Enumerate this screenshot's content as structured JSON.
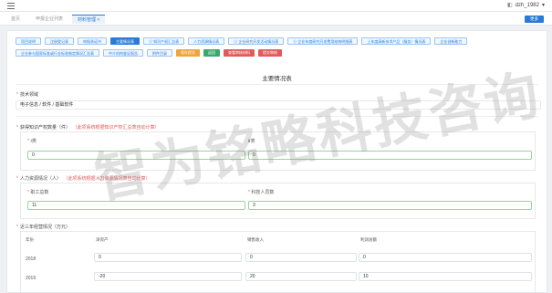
{
  "header": {
    "user_name": "dzh_1982"
  },
  "tabs": [
    {
      "label": "首页"
    },
    {
      "label": "申报企业列表"
    },
    {
      "label": "材料管理"
    }
  ],
  "more_button": "更多",
  "toolbar_row1": [
    "项目说明",
    "注册登记表",
    "申报承诺书",
    "主要情况表",
    "知识产权汇总表",
    "人力资源情况表",
    "企业研究开发活动情况表",
    "企业年度研究开发费用结构明细表",
    "上年度高新技术产品（服务）情况表",
    "企业创新能力"
  ],
  "toolbar_row2": [
    "企业参与国家标准或行业标准制定情况汇总表",
    "中介机构鉴证报告",
    "附件目录",
    "保存提交",
    "返回",
    "查看审核材料",
    "提交审核"
  ],
  "form": {
    "title": "主要情况表",
    "tech_field": {
      "label": "技术领域",
      "value": "电子信息 / 软件 / 基础软件"
    },
    "ip": {
      "label": "获得知识产权数量（件）",
      "note": "（此项系统根据知识产权汇总表自动计算）",
      "class1_label": "Ⅰ类",
      "class1_value": "0",
      "class2_label": "Ⅱ类",
      "class2_value": "0"
    },
    "hr": {
      "label": "人力资源情况（人）",
      "note": "（此项系统根据人力资源情况表自动计算）",
      "staff_label": "职工总数",
      "staff_value": "11",
      "tech_label": "科技人员数",
      "tech_value": "3"
    },
    "finance": {
      "label": "近三年经营情况（万元）",
      "headers": [
        "年份",
        "净资产",
        "销售收入",
        "利润总额"
      ],
      "rows": [
        {
          "year": "2018",
          "values": [
            "0",
            "0",
            "0"
          ]
        },
        {
          "year": "2019",
          "values": [
            "-20",
            "20",
            "10"
          ]
        }
      ]
    }
  },
  "watermark": "智为铭略科技咨询"
}
